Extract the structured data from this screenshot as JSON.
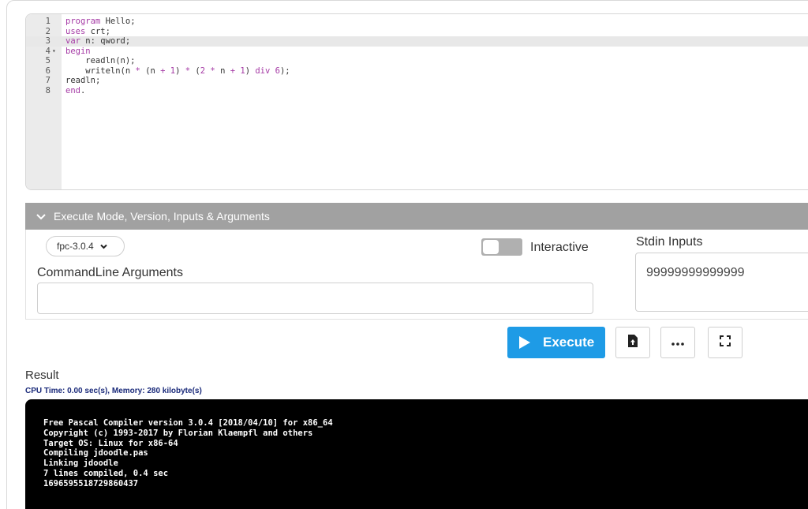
{
  "editor": {
    "lines": [
      {
        "num": "1",
        "fold": "",
        "parts": [
          {
            "t": "program",
            "c": "kw"
          },
          {
            "t": " Hello;",
            "c": ""
          }
        ]
      },
      {
        "num": "2",
        "fold": "",
        "parts": [
          {
            "t": "uses",
            "c": "kw"
          },
          {
            "t": " crt;",
            "c": ""
          }
        ]
      },
      {
        "num": "3",
        "fold": "",
        "parts": [
          {
            "t": "var",
            "c": "kw"
          },
          {
            "t": " n: qword;",
            "c": ""
          }
        ]
      },
      {
        "num": "4",
        "fold": "▾",
        "parts": [
          {
            "t": "begin",
            "c": "kw"
          }
        ]
      },
      {
        "num": "5",
        "fold": "",
        "parts": [
          {
            "t": "    readln(n);",
            "c": ""
          }
        ]
      },
      {
        "num": "6",
        "fold": "",
        "parts": [
          {
            "t": "    writeln(n ",
            "c": ""
          },
          {
            "t": "*",
            "c": "op"
          },
          {
            "t": " (n ",
            "c": ""
          },
          {
            "t": "+",
            "c": "op"
          },
          {
            "t": " ",
            "c": ""
          },
          {
            "t": "1",
            "c": "num"
          },
          {
            "t": ") ",
            "c": ""
          },
          {
            "t": "*",
            "c": "op"
          },
          {
            "t": " (",
            "c": ""
          },
          {
            "t": "2",
            "c": "num"
          },
          {
            "t": " ",
            "c": ""
          },
          {
            "t": "*",
            "c": "op"
          },
          {
            "t": " n ",
            "c": ""
          },
          {
            "t": "+",
            "c": "op"
          },
          {
            "t": " ",
            "c": ""
          },
          {
            "t": "1",
            "c": "num"
          },
          {
            "t": ") ",
            "c": ""
          },
          {
            "t": "div",
            "c": "kw"
          },
          {
            "t": " ",
            "c": ""
          },
          {
            "t": "6",
            "c": "num"
          },
          {
            "t": ");",
            "c": ""
          }
        ]
      },
      {
        "num": "7",
        "fold": "",
        "parts": [
          {
            "t": "readln",
            "c": ""
          },
          {
            "t": ";",
            "c": ""
          }
        ]
      },
      {
        "num": "8",
        "fold": "",
        "parts": [
          {
            "t": "end",
            "c": "kw"
          },
          {
            "t": ".",
            "c": ""
          }
        ]
      }
    ],
    "active_line": 2
  },
  "mode_panel": {
    "header": "Execute Mode, Version, Inputs & Arguments",
    "version": "fpc-3.0.4",
    "interactive_label": "Interactive",
    "interactive_on": false,
    "cmdline_label": "CommandLine Arguments",
    "cmdline_value": "",
    "stdin_label": "Stdin Inputs",
    "stdin_value": "99999999999999"
  },
  "toolbar": {
    "execute_label": "Execute",
    "accent": "#1e9be6",
    "icons": [
      "upload-file-icon",
      "more-icon",
      "fullscreen-icon"
    ]
  },
  "result": {
    "label": "Result",
    "cpu_info": "CPU Time: 0.00 sec(s), Memory: 280 kilobyte(s)",
    "output": [
      "Free Pascal Compiler version 3.0.4 [2018/04/10] for x86_64",
      "Copyright (c) 1993-2017 by Florian Klaempfl and others",
      "Target OS: Linux for x86-64",
      "Compiling jdoodle.pas",
      "Linking jdoodle",
      "7 lines compiled, 0.4 sec",
      "1696595518729860437"
    ]
  }
}
